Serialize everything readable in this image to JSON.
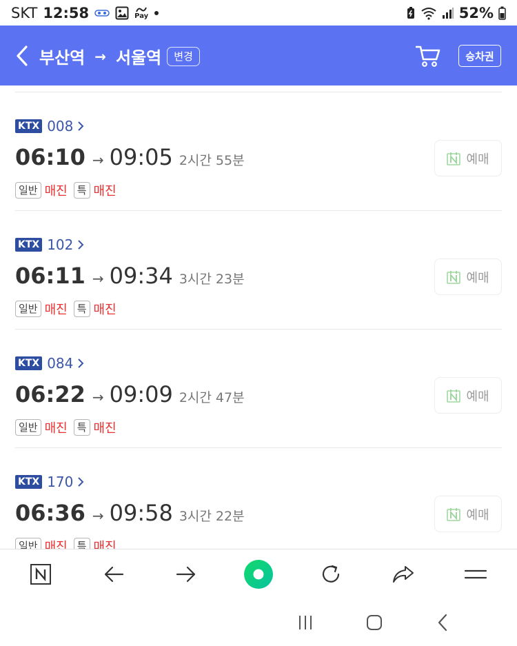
{
  "status_bar": {
    "carrier": "SKT",
    "clock": "12:58",
    "pay_icon_label": "Pay",
    "battery": "52%"
  },
  "header": {
    "from": "부산역",
    "arrow": "→",
    "to": "서울역",
    "change_label": "변경",
    "ticket_label": "승차권",
    "accent": "#5b73f2"
  },
  "trains": [
    {
      "type": "KTX",
      "number": "008",
      "depart": "06:10",
      "arrive": "09:05",
      "duration": "2시간 55분",
      "general_label": "일반",
      "general_status": "매진",
      "special_label": "특",
      "special_status": "매진",
      "reserve_label": "예매"
    },
    {
      "type": "KTX",
      "number": "102",
      "depart": "06:11",
      "arrive": "09:34",
      "duration": "3시간 23분",
      "general_label": "일반",
      "general_status": "매진",
      "special_label": "특",
      "special_status": "매진",
      "reserve_label": "예매"
    },
    {
      "type": "KTX",
      "number": "084",
      "depart": "06:22",
      "arrive": "09:09",
      "duration": "2시간 47분",
      "general_label": "일반",
      "general_status": "매진",
      "special_label": "특",
      "special_status": "매진",
      "reserve_label": "예매"
    },
    {
      "type": "KTX",
      "number": "170",
      "depart": "06:36",
      "arrive": "09:58",
      "duration": "3시간 22분",
      "general_label": "일반",
      "general_status": "매진",
      "special_label": "특",
      "special_status": "매진",
      "reserve_label": "예매"
    }
  ],
  "bottom_bar": {
    "icons": [
      "naver-n-icon",
      "back-arrow-icon",
      "forward-arrow-icon",
      "green-dot-icon",
      "refresh-icon",
      "share-icon",
      "menu-icon"
    ]
  },
  "nav_bar": {
    "icons": [
      "recent-apps-icon",
      "home-icon",
      "back-icon"
    ]
  }
}
